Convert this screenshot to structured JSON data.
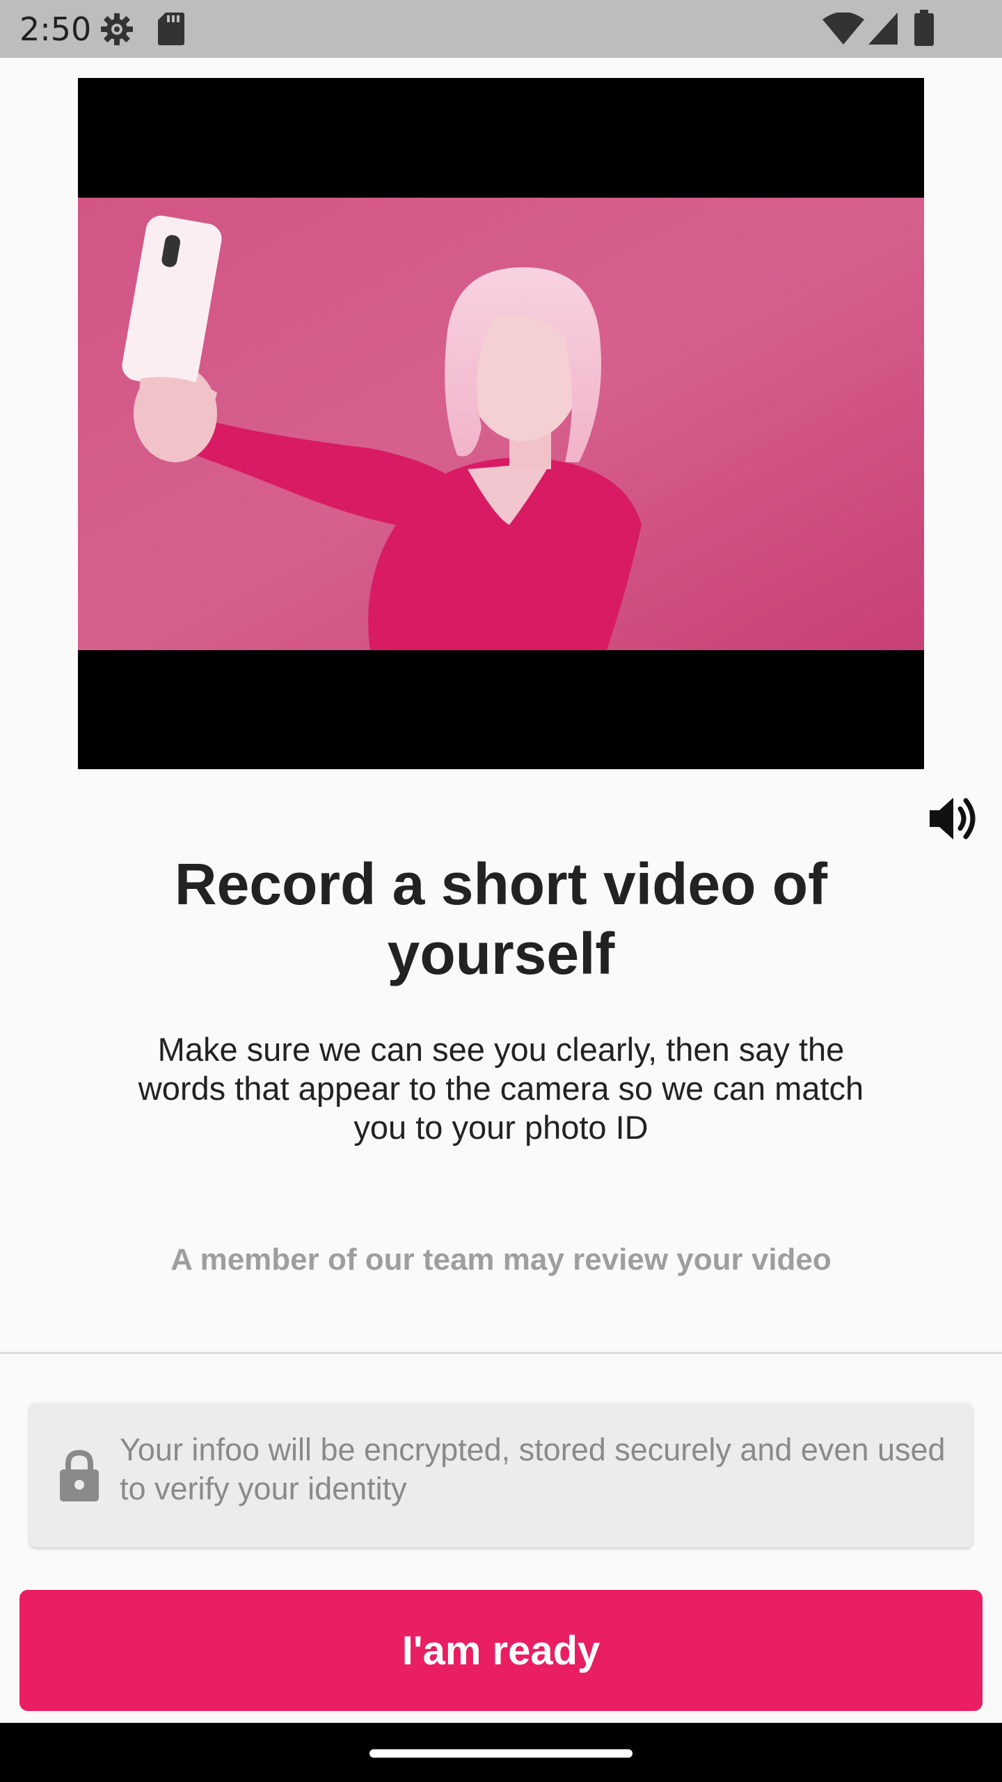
{
  "status_bar": {
    "time": "2:50",
    "left_icons": [
      "settings-gear-icon",
      "sd-card-icon"
    ],
    "right_icons": [
      "wifi-icon",
      "signal-icon",
      "battery-icon"
    ]
  },
  "video": {
    "volume_icon": "volume-up-icon"
  },
  "content": {
    "title": "Record a short video of yourself",
    "description": "Make sure we can see you clearly, then say the words that appear to the camera so we can match you to your photo ID",
    "review_note": "A member of our team may review your video"
  },
  "info_card": {
    "icon": "lock-icon",
    "text": "Your infoo will be encrypted, stored securely and even used to verify your identity"
  },
  "primary_button": {
    "label": "I'am ready"
  },
  "colors": {
    "accent": "#e91e63",
    "background": "#fafafa",
    "status_bar": "#bdbdbd",
    "muted_text": "#9e9e9e"
  }
}
